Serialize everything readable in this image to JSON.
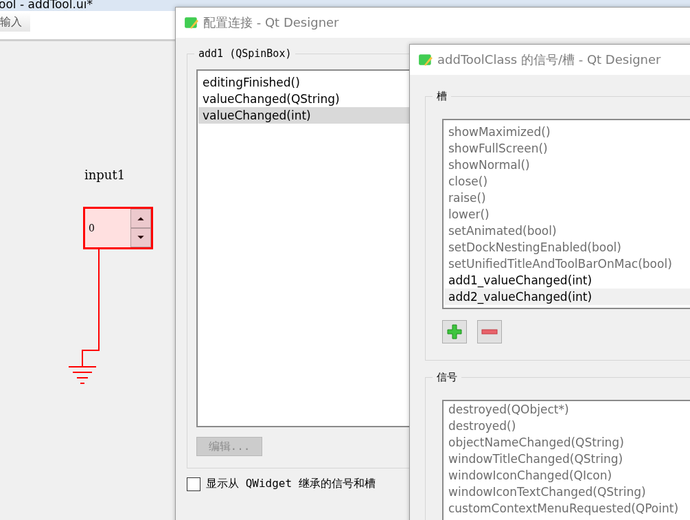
{
  "main_window": {
    "title": "ool - addTool.ui*",
    "toolbar_tab": "输入",
    "canvas": {
      "component_label": "input1",
      "spinbox_value": "0"
    }
  },
  "connect_dialog": {
    "title": "配置连接 - Qt Designer",
    "group_title": "add1 (QSpinBox)",
    "signals": [
      {
        "label": "editingFinished()",
        "selected": false
      },
      {
        "label": "valueChanged(QString)",
        "selected": false
      },
      {
        "label": "valueChanged(int)",
        "selected": true
      }
    ],
    "edit_button": {
      "label": "编辑...",
      "disabled": true
    },
    "inherit_checkbox": {
      "label": "显示从 QWidget 继承的信号和槽",
      "checked": false
    }
  },
  "slots_dialog": {
    "title": "addToolClass 的信号/槽 - Qt Designer",
    "slots_group": {
      "title": "槽",
      "items": [
        {
          "label": "showMaximized()",
          "dimmed": true,
          "selected": false
        },
        {
          "label": "showFullScreen()",
          "dimmed": true,
          "selected": false
        },
        {
          "label": "showNormal()",
          "dimmed": true,
          "selected": false
        },
        {
          "label": "close()",
          "dimmed": true,
          "selected": false
        },
        {
          "label": "raise()",
          "dimmed": true,
          "selected": false
        },
        {
          "label": "lower()",
          "dimmed": true,
          "selected": false
        },
        {
          "label": "setAnimated(bool)",
          "dimmed": true,
          "selected": false
        },
        {
          "label": "setDockNestingEnabled(bool)",
          "dimmed": true,
          "selected": false
        },
        {
          "label": "setUnifiedTitleAndToolBarOnMac(bool)",
          "dimmed": true,
          "selected": false
        },
        {
          "label": "add1_valueChanged(int)",
          "dimmed": false,
          "selected": false
        },
        {
          "label": "add2_valueChanged(int)",
          "dimmed": false,
          "selected": true
        }
      ]
    },
    "signals_group": {
      "title": "信号",
      "items": [
        {
          "label": "destroyed(QObject*)",
          "dimmed": true,
          "selected": false
        },
        {
          "label": "destroyed()",
          "dimmed": true,
          "selected": false
        },
        {
          "label": "objectNameChanged(QString)",
          "dimmed": true,
          "selected": false
        },
        {
          "label": "windowTitleChanged(QString)",
          "dimmed": true,
          "selected": false
        },
        {
          "label": "windowIconChanged(QIcon)",
          "dimmed": true,
          "selected": false
        },
        {
          "label": "windowIconTextChanged(QString)",
          "dimmed": true,
          "selected": false
        },
        {
          "label": "customContextMenuRequested(QPoint)",
          "dimmed": true,
          "selected": false
        }
      ]
    }
  }
}
